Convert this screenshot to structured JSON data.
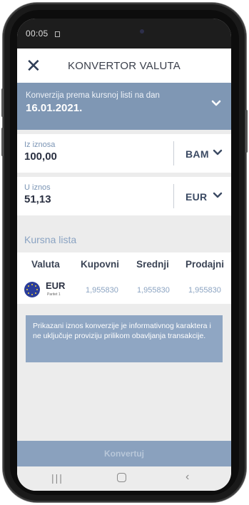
{
  "status_bar": {
    "time": "00:05"
  },
  "header": {
    "close_icon": "close-icon",
    "title": "KONVERTOR VALUTA"
  },
  "date_panel": {
    "label": "Konverzija prema kursnoj listi na dan",
    "date": "16.01.2021."
  },
  "from_field": {
    "label": "Iz iznosa",
    "value": "100,00",
    "currency": "BAM"
  },
  "to_field": {
    "label": "U iznos",
    "value": "51,13",
    "currency": "EUR"
  },
  "rates": {
    "title": "Kursna lista",
    "columns": [
      "Valuta",
      "Kupovni",
      "Srednji",
      "Prodajni"
    ],
    "rows": [
      {
        "code": "EUR",
        "sub": "Paritet 1",
        "kupovni": "1,955830",
        "srednji": "1,955830",
        "prodajni": "1,955830"
      }
    ]
  },
  "notice": "Prikazani iznos konverzije je informativnog karaktera i ne uključuje proviziju prilikom obavljanja transakcije.",
  "convert_button": "Konvertuj",
  "colors": {
    "accent": "#7f97b4",
    "text_dark": "#2b3142",
    "label_blue": "#7a94b4"
  }
}
